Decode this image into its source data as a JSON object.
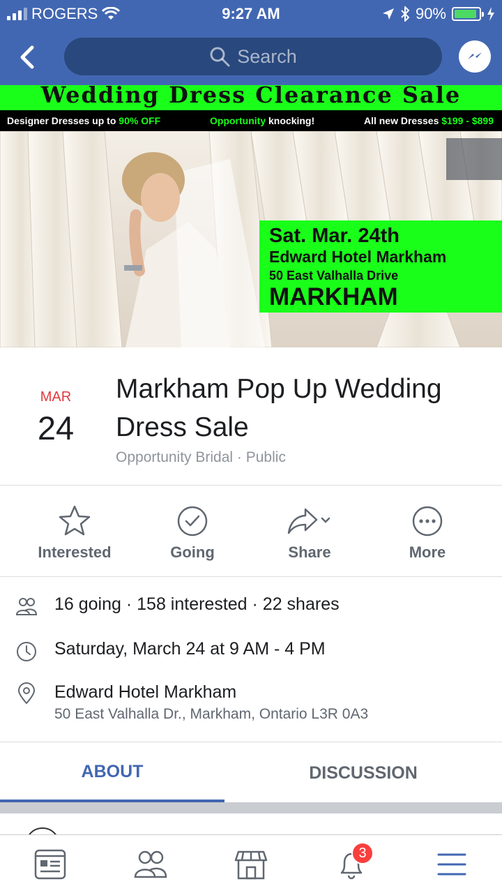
{
  "status_bar": {
    "carrier": "ROGERS",
    "time": "9:27 AM",
    "battery": "90%",
    "battery_level": 0.9
  },
  "nav": {
    "search_placeholder": "Search",
    "icons": [
      "back-chevron-icon",
      "search-icon",
      "messenger-icon"
    ]
  },
  "cover": {
    "banner_title": "Wedding Dress Clearance Sale",
    "strip": {
      "part1": "Designer Dresses up to ",
      "part1_hl": "90% OFF",
      "part2_hl": "Opportunity",
      "part2": " knocking!",
      "part3": "All new Dresses ",
      "part3_hl": "$199 - $899"
    },
    "box": {
      "line1": "Sat. Mar. 24th",
      "line2": "Edward Hotel Markham",
      "line3": "50 East Valhalla Drive",
      "line4": "MARKHAM"
    }
  },
  "event": {
    "month": "MAR",
    "day": "24",
    "title": "Markham Pop Up Wedding Dress Sale",
    "subtitle": "Opportunity Bridal · Public"
  },
  "actions": [
    {
      "label": "Interested",
      "icon": "star-icon"
    },
    {
      "label": "Going",
      "icon": "checkmark-circle-icon"
    },
    {
      "label": "Share",
      "icon": "share-arrow-icon"
    },
    {
      "label": "More",
      "icon": "more-dots-icon"
    }
  ],
  "details": {
    "stats": "16 going · 158 interested · 22 shares",
    "datetime": "Saturday, March 24 at 9 AM - 4 PM",
    "venue": "Edward Hotel Markham",
    "address": "50 East Valhalla Dr., Markham, Ontario L3R 0A3"
  },
  "tabs": {
    "about": "ABOUT",
    "discussion": "DISCUSSION"
  },
  "tabbar": {
    "notifications_count": "3",
    "items": [
      "news-feed-icon",
      "friends-icon",
      "marketplace-icon",
      "notifications-bell-icon",
      "menu-icon"
    ]
  },
  "colors": {
    "brand": "#4267b2",
    "banner_green": "#1aff1a",
    "date_red": "#e0393e",
    "badge_red": "#fa3e3e"
  }
}
